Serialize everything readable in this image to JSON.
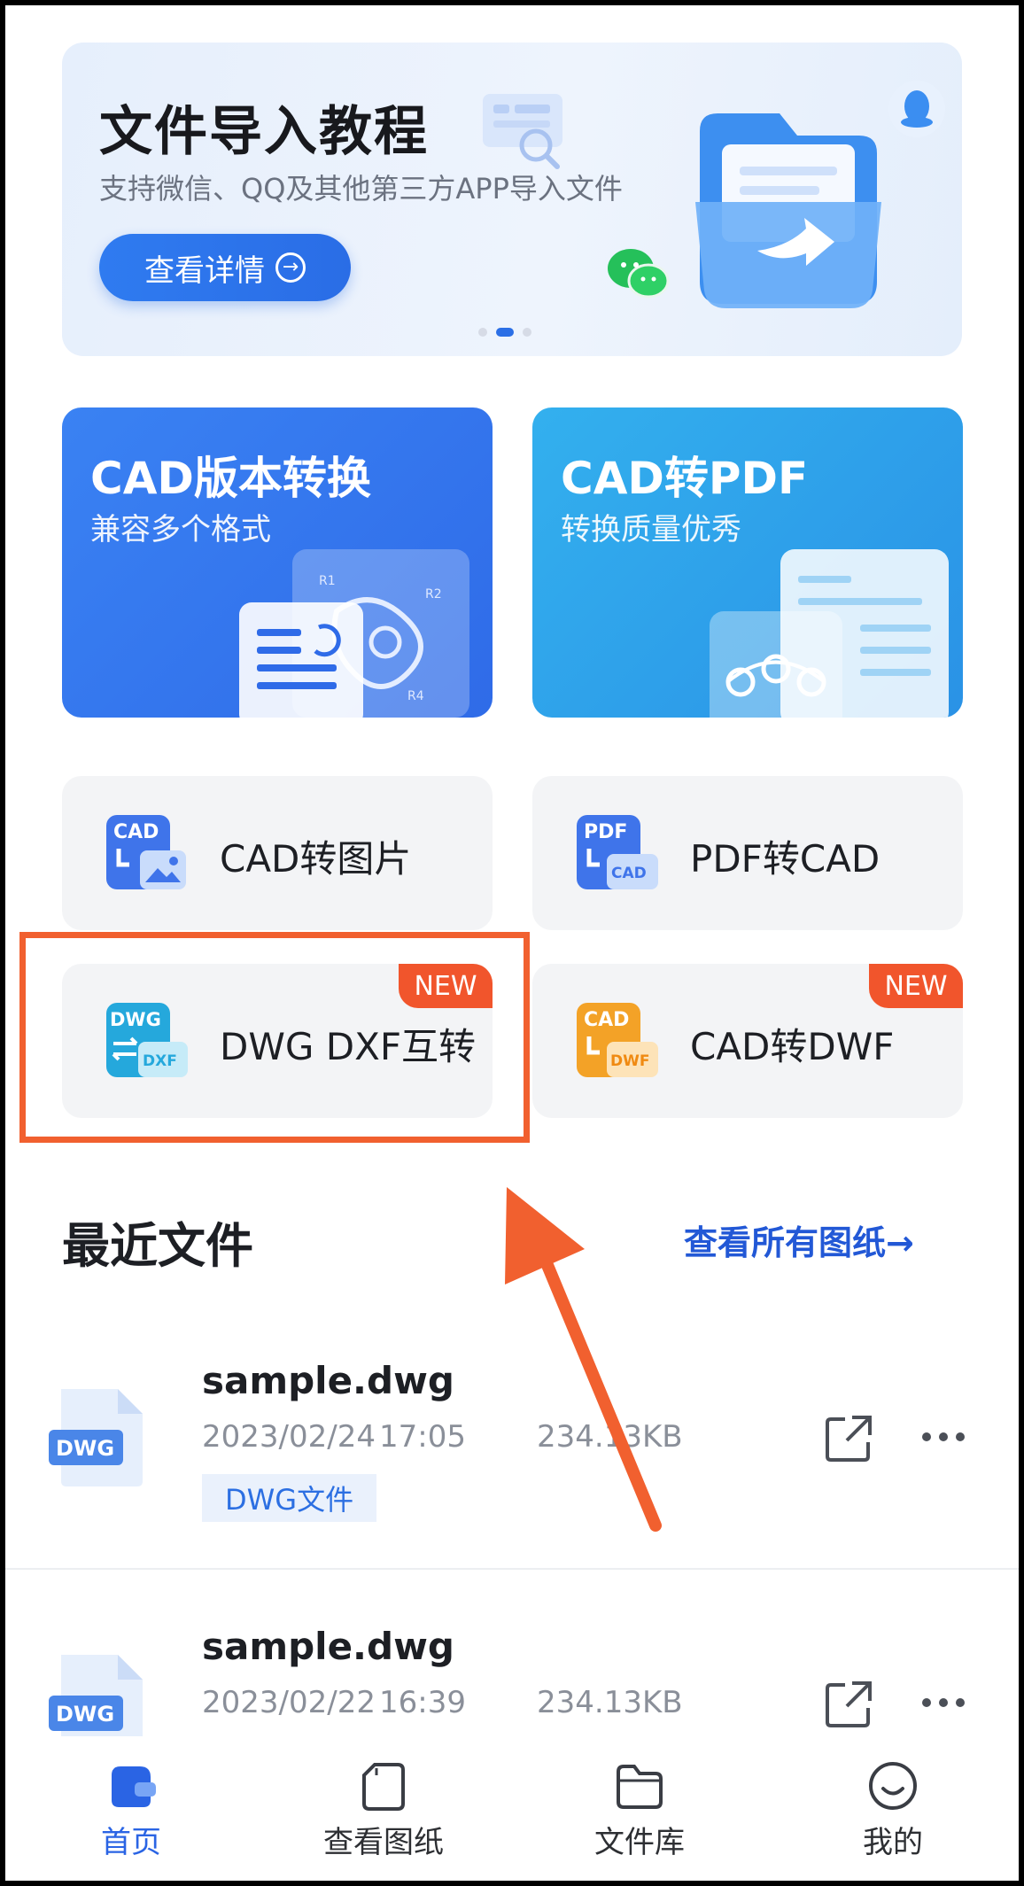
{
  "banner": {
    "title": "文件导入教程",
    "subtitle": "支持微信、QQ及其他第三方APP导入文件",
    "button_label": "查看详情",
    "button_icon": "arrow-right-circle-icon"
  },
  "feature_cards": [
    {
      "title": "CAD版本转换",
      "subtitle": "兼容多个格式"
    },
    {
      "title": "CAD转PDF",
      "subtitle": "转换质量优秀"
    }
  ],
  "tools": [
    {
      "label": "CAD转图片",
      "icon_top": "CAD",
      "icon_bottom": "",
      "new": false
    },
    {
      "label": "PDF转CAD",
      "icon_top": "PDF",
      "icon_bottom": "CAD",
      "new": false
    },
    {
      "label": "DWG DXF互转",
      "icon_top": "DWG",
      "icon_bottom": "DXF",
      "new": true,
      "badge": "NEW"
    },
    {
      "label": "CAD转DWF",
      "icon_top": "CAD",
      "icon_bottom": "DWF",
      "new": true,
      "badge": "NEW"
    }
  ],
  "recent": {
    "title": "最近文件",
    "view_all": "查看所有图纸→",
    "files": [
      {
        "icon_label": "DWG",
        "name": "sample.dwg",
        "date": "2023/02/24",
        "time": "17:05",
        "size": "234.13KB",
        "tag": "DWG文件"
      },
      {
        "icon_label": "DWG",
        "name": "sample.dwg",
        "date": "2023/02/22",
        "time": "16:39",
        "size": "234.13KB"
      }
    ]
  },
  "nav": [
    {
      "label": "首页",
      "icon": "home-icon",
      "active": true
    },
    {
      "label": "查看图纸",
      "icon": "drawing-icon",
      "active": false
    },
    {
      "label": "文件库",
      "icon": "folder-icon",
      "active": false
    },
    {
      "label": "我的",
      "icon": "smiley-profile-icon",
      "active": false
    }
  ],
  "colors": {
    "accent": "#2a64e4",
    "highlight": "#f1602f",
    "new_badge": "#f1552c"
  }
}
